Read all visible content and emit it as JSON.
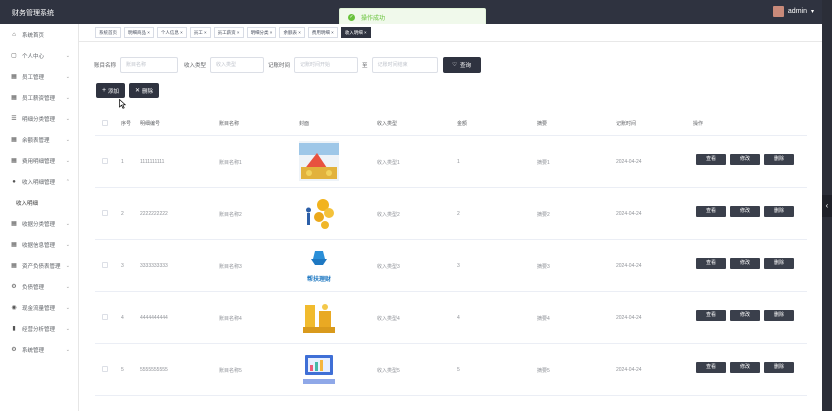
{
  "app": {
    "title": "财务管理系统",
    "user": "admin"
  },
  "toast": {
    "message": "操作成功"
  },
  "sidebar": {
    "items": [
      {
        "label": "系统首页",
        "icon": "home-icon"
      },
      {
        "label": "个人中心",
        "icon": "calendar-icon"
      },
      {
        "label": "员工管理",
        "icon": "grid-icon"
      },
      {
        "label": "员工薪资管理",
        "icon": "grid-icon"
      },
      {
        "label": "明细分类管理",
        "icon": "list-icon"
      },
      {
        "label": "余额表管理",
        "icon": "grid-icon"
      },
      {
        "label": "费用明细管理",
        "icon": "grid-icon"
      },
      {
        "label": "收入明细管理",
        "icon": "user-icon"
      },
      {
        "label": "收入明细",
        "icon": "",
        "sub": true
      },
      {
        "label": "收据分类管理",
        "icon": "grid-icon"
      },
      {
        "label": "收据信息管理",
        "icon": "grid-icon"
      },
      {
        "label": "资产负债表管理",
        "icon": "grid-icon"
      },
      {
        "label": "负债管理",
        "icon": "gear-icon"
      },
      {
        "label": "现金流量管理",
        "icon": "coins-icon"
      },
      {
        "label": "经营分析管理",
        "icon": "chart-icon"
      },
      {
        "label": "系统管理",
        "icon": "gear-icon"
      }
    ]
  },
  "tags": [
    {
      "label": "系统首页"
    },
    {
      "label": "明细商品 ×"
    },
    {
      "label": "个人信息 ×"
    },
    {
      "label": "员工 ×"
    },
    {
      "label": "员工薪资 ×"
    },
    {
      "label": "明细分类 ×"
    },
    {
      "label": "余额表 ×"
    },
    {
      "label": "费用明细 ×"
    },
    {
      "label": "收入明细 ×",
      "active": true
    }
  ],
  "search": {
    "account_label": "账目名称",
    "account_placeholder": "账目名称",
    "type_label": "收入类型",
    "type_placeholder": "收入类型",
    "time_label": "记账时间",
    "time_start_placeholder": "记账时间开始",
    "to_label": "至",
    "time_end_placeholder": "记账时间结束",
    "query_label": "查询"
  },
  "actions": {
    "add_label": "添加",
    "delete_label": "删除"
  },
  "table": {
    "headers": [
      "序号",
      "明细编号",
      "账目名称",
      "封面",
      "收入类型",
      "金额",
      "摘要",
      "记账时间",
      "操作"
    ],
    "rows": [
      {
        "index": "1",
        "code": "1111111111",
        "name": "账目名称1",
        "type": "收入类型1",
        "amount": "1",
        "summary": "摘要1",
        "date": "2024-04-24"
      },
      {
        "index": "2",
        "code": "2222222222",
        "name": "账目名称2",
        "type": "收入类型2",
        "amount": "2",
        "summary": "摘要2",
        "date": "2024-04-24"
      },
      {
        "index": "3",
        "code": "3333333333",
        "name": "账目名称3",
        "type": "收入类型3",
        "amount": "3",
        "summary": "摘要3",
        "date": "2024-04-24",
        "cover_text": "帮扶理财"
      },
      {
        "index": "4",
        "code": "4444444444",
        "name": "账目名称4",
        "type": "收入类型4",
        "amount": "4",
        "summary": "摘要4",
        "date": "2024-04-24"
      },
      {
        "index": "5",
        "code": "5555555555",
        "name": "账目名称5",
        "type": "收入类型5",
        "amount": "5",
        "summary": "摘要5",
        "date": "2024-04-24"
      }
    ],
    "op_view": "查看",
    "op_edit": "修改",
    "op_delete": "删除"
  },
  "colors": {
    "header": "#2f3340",
    "button": "#3a3f4b",
    "success": "#67c23a"
  }
}
